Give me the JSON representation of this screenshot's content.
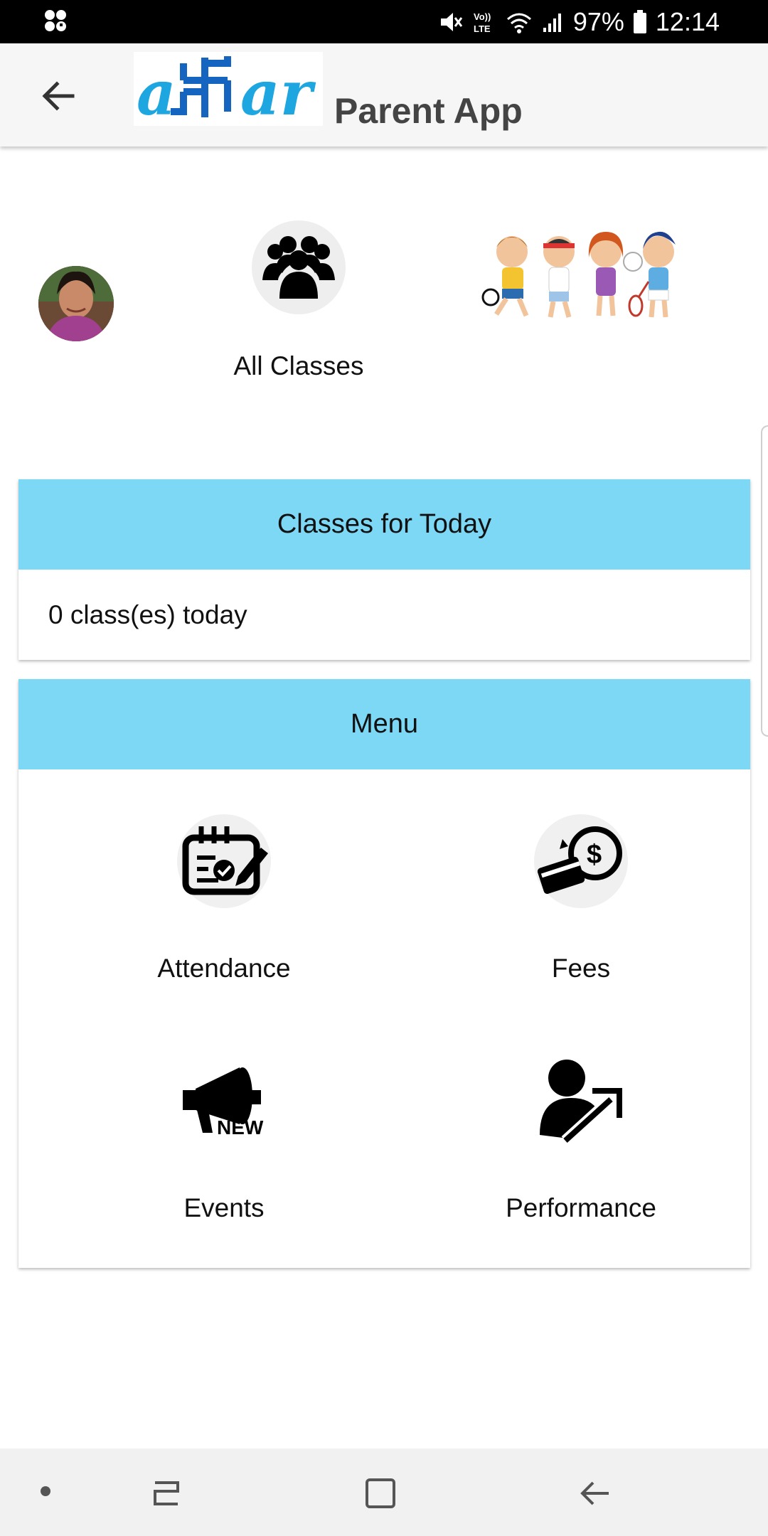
{
  "status_bar": {
    "battery_percent": "97%",
    "time": "12:14",
    "icons": [
      "notifications-icon",
      "mute-icon",
      "volte-icon",
      "wifi-icon",
      "signal-icon",
      "battery-icon"
    ],
    "volte_label": "Vo)) LTE"
  },
  "app_bar": {
    "title": "Parent App",
    "logo_text": "aFar"
  },
  "header": {
    "all_classes_label": "All Classes"
  },
  "today_card": {
    "title": "Classes for Today",
    "summary": "0 class(es) today"
  },
  "menu_card": {
    "title": "Menu",
    "items": [
      {
        "label": "Attendance",
        "icon": "attendance-icon"
      },
      {
        "label": "Fees",
        "icon": "fees-icon"
      },
      {
        "label": "Events",
        "icon": "megaphone-new-icon",
        "icon_text": "NEW"
      },
      {
        "label": "Performance",
        "icon": "performance-icon"
      }
    ]
  },
  "colors": {
    "card_header_bg": "#7dd8f6",
    "app_bar_bg": "#f6f6f6",
    "logo_blue": "#1ea6e0"
  }
}
